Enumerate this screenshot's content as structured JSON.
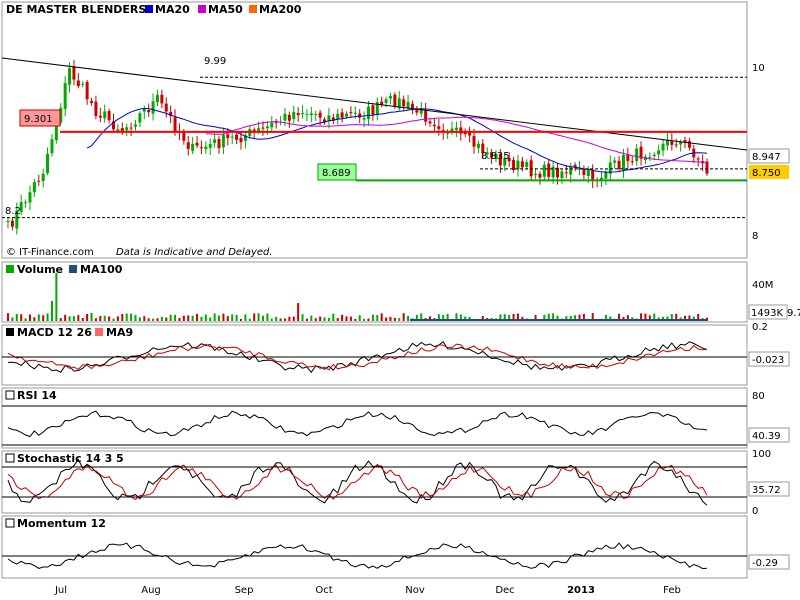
{
  "chart_data": {
    "type": "stock-chart",
    "title": "DE MASTER BLENDERS",
    "credit": "© IT-Finance.com",
    "disclaimer": "Data is Indicative and Delayed.",
    "x_labels": [
      "Jul",
      "Aug",
      "Sep",
      "Oct",
      "Nov",
      "Dec",
      "2013",
      "Feb"
    ],
    "price": {
      "legend": [
        {
          "name": "MA20",
          "color": "#0000cc"
        },
        {
          "name": "MA50",
          "color": "#cc00cc"
        },
        {
          "name": "MA200",
          "color": "#ff6600"
        }
      ],
      "y_ticks": [
        "10",
        "8"
      ],
      "ylim": [
        8.0,
        10.12
      ],
      "ref_levels": [
        {
          "label": "9.99",
          "value": 9.99,
          "color": "#000000"
        },
        {
          "label": "9.301",
          "value": 9.301,
          "color": "#ff0000"
        },
        {
          "label": "8.689",
          "value": 8.689,
          "color": "#00aa00"
        },
        {
          "label": "8.835",
          "value": 8.835,
          "color": "#000000"
        },
        {
          "label": "8.2",
          "value": 8.22,
          "color": "#000000"
        }
      ],
      "last_ma20": "8.947",
      "last_ma20_color": "#cc00cc",
      "last_close": "8.750",
      "last_close_bg": "#ffcc00",
      "trendline": {
        "start": 10.1,
        "end": 8.98
      }
    },
    "volume": {
      "legend": [
        {
          "name": "Volume",
          "color": "#00aa00"
        },
        {
          "name": "MA100",
          "color": "#1f4e79"
        }
      ],
      "y_tick": "40M",
      "last_value": "1493K",
      "last_value_color": "#ff0000",
      "ma_value": "9.7"
    },
    "macd": {
      "legend": [
        {
          "name": "MACD 12 26",
          "color": "#000000"
        },
        {
          "name": "MA9",
          "color": "#ff6666"
        }
      ],
      "y_tick": "0.2",
      "last_value": "-0.023"
    },
    "rsi": {
      "legend": [
        {
          "name": "RSI 14",
          "color": "#000000"
        }
      ],
      "y_tick": "80",
      "last_value": "40.39"
    },
    "stochastic": {
      "legend": [
        {
          "name": "Stochastic 14 3 5",
          "color": "#000000"
        }
      ],
      "y_ticks": [
        "100",
        "0"
      ],
      "last_value": "35.72",
      "last_value_color": "#ff0000"
    },
    "momentum": {
      "legend": [
        {
          "name": "Momentum 12",
          "color": "#000000"
        }
      ],
      "last_value": "-0.29"
    }
  }
}
